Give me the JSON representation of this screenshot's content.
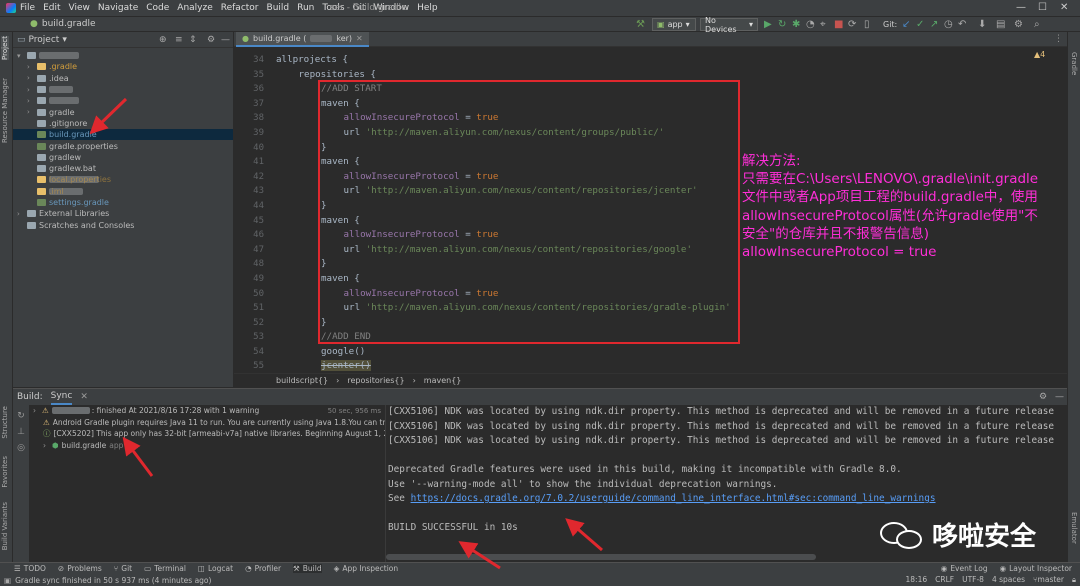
{
  "menubar": {
    "items": [
      "File",
      "Edit",
      "View",
      "Navigate",
      "Code",
      "Analyze",
      "Refactor",
      "Build",
      "Run",
      "Tools",
      "Git",
      "Window",
      "Help"
    ],
    "window_title": "ser - build.gradle"
  },
  "navbar": {
    "breadcrumb": "build.gradle",
    "run_config": "app",
    "device": "No Devices",
    "git_label": "Git:"
  },
  "project_panel": {
    "title": "Project",
    "items": [
      {
        "label": "",
        "level": 0,
        "arrow": "▾",
        "icon": "folder",
        "blurred": true,
        "blur_w": 40
      },
      {
        "label": ".gradle",
        "level": 1,
        "arrow": "›",
        "icon": "folder-orange",
        "color": "#d29e3c"
      },
      {
        "label": ".idea",
        "level": 1,
        "arrow": "›",
        "icon": "folder"
      },
      {
        "label": "",
        "level": 1,
        "arrow": "›",
        "icon": "folder",
        "blurred": true,
        "blur_w": 24
      },
      {
        "label": "",
        "level": 1,
        "arrow": "›",
        "icon": "folder",
        "blurred": true,
        "blur_w": 30
      },
      {
        "label": "gradle",
        "level": 1,
        "arrow": "›",
        "icon": "folder"
      },
      {
        "label": ".gitignore",
        "level": 1,
        "arrow": "",
        "icon": "file"
      },
      {
        "label": "build.gradle",
        "level": 1,
        "arrow": "",
        "icon": "gradle",
        "selected": true,
        "color": "#6897bb"
      },
      {
        "label": "gradle.properties",
        "level": 1,
        "arrow": "",
        "icon": "gradle"
      },
      {
        "label": "gradlew",
        "level": 1,
        "arrow": "",
        "icon": "file"
      },
      {
        "label": "gradlew.bat",
        "level": 1,
        "arrow": "",
        "icon": "file"
      },
      {
        "label": "local.properties",
        "level": 1,
        "arrow": "",
        "icon": "file-orange",
        "color": "#d29e3c",
        "blurred": true,
        "blur_w": 50
      },
      {
        "label": ".iml",
        "level": 1,
        "arrow": "",
        "icon": "file-orange",
        "color": "#d29e3c",
        "blurred": true,
        "blur_w": 34
      },
      {
        "label": "settings.gradle",
        "level": 1,
        "arrow": "",
        "icon": "gradle",
        "color": "#6897bb"
      },
      {
        "label": "External Libraries",
        "level": 0,
        "arrow": "›",
        "icon": "lib"
      },
      {
        "label": "Scratches and Consoles",
        "level": 0,
        "arrow": "",
        "icon": "scratch"
      }
    ]
  },
  "editor": {
    "tab_label": "build.gradle (",
    "tab_label_suffix": "ker)",
    "warnings": "▲4",
    "line_numbers": [
      "34",
      "35",
      "36",
      "37",
      "38",
      "39",
      "40",
      "41",
      "42",
      "43",
      "44",
      "45",
      "46",
      "47",
      "48",
      "49",
      "50",
      "51",
      "52",
      "53",
      "54",
      "55"
    ],
    "breadcrumbs": [
      "buildscript{}",
      "repositories{}",
      "maven{}"
    ],
    "code_lines": [
      {
        "indent": 0,
        "parts": [
          [
            "id",
            "allprojects {"
          ]
        ]
      },
      {
        "indent": 1,
        "parts": [
          [
            "id",
            "repositories {"
          ]
        ]
      },
      {
        "indent": 2,
        "parts": [
          [
            "cm",
            "//ADD START"
          ]
        ]
      },
      {
        "indent": 2,
        "parts": [
          [
            "id",
            "maven {"
          ]
        ]
      },
      {
        "indent": 3,
        "parts": [
          [
            "pr",
            "allowInsecureProtocol"
          ],
          [
            "id",
            " = "
          ],
          [
            "kw",
            "true"
          ]
        ]
      },
      {
        "indent": 3,
        "parts": [
          [
            "id",
            "url "
          ],
          [
            "str",
            "'http://maven.aliyun.com/nexus/content/groups/public/'"
          ]
        ]
      },
      {
        "indent": 2,
        "parts": [
          [
            "id",
            "}"
          ]
        ]
      },
      {
        "indent": 2,
        "parts": [
          [
            "id",
            "maven {"
          ]
        ]
      },
      {
        "indent": 3,
        "parts": [
          [
            "pr",
            "allowInsecureProtocol"
          ],
          [
            "id",
            " = "
          ],
          [
            "kw",
            "true"
          ]
        ]
      },
      {
        "indent": 3,
        "parts": [
          [
            "id",
            "url "
          ],
          [
            "str",
            "'http://maven.aliyun.com/nexus/content/repositories/jcenter'"
          ]
        ]
      },
      {
        "indent": 2,
        "parts": [
          [
            "id",
            "}"
          ]
        ]
      },
      {
        "indent": 2,
        "parts": [
          [
            "id",
            "maven {"
          ]
        ]
      },
      {
        "indent": 3,
        "parts": [
          [
            "pr",
            "allowInsecureProtocol"
          ],
          [
            "id",
            " = "
          ],
          [
            "kw",
            "true"
          ]
        ]
      },
      {
        "indent": 3,
        "parts": [
          [
            "id",
            "url "
          ],
          [
            "str",
            "'http://maven.aliyun.com/nexus/content/repositories/google'"
          ]
        ]
      },
      {
        "indent": 2,
        "parts": [
          [
            "id",
            "}"
          ]
        ]
      },
      {
        "indent": 2,
        "parts": [
          [
            "id",
            "maven {"
          ]
        ]
      },
      {
        "indent": 3,
        "parts": [
          [
            "pr",
            "allowInsecureProtocol"
          ],
          [
            "id",
            " = "
          ],
          [
            "kw",
            "true"
          ]
        ]
      },
      {
        "indent": 3,
        "parts": [
          [
            "id",
            "url "
          ],
          [
            "str",
            "'http://maven.aliyun.com/nexus/content/repositories/gradle-plugin'"
          ]
        ]
      },
      {
        "indent": 2,
        "parts": [
          [
            "id",
            "}"
          ]
        ]
      },
      {
        "indent": 2,
        "parts": [
          [
            "cm",
            "//ADD END"
          ]
        ]
      },
      {
        "indent": 2,
        "parts": [
          [
            "id",
            "google()"
          ]
        ]
      },
      {
        "indent": 2,
        "parts": [
          [
            "strike",
            "jcenter()"
          ]
        ]
      }
    ]
  },
  "annotation": {
    "lines": [
      "解决方法:",
      "只需要在C:\\Users\\LENOVO\\.gradle\\init.gradle",
      "文件中或者App项目工程的build.gradle中，使用",
      "allowInsecureProtocol属性(允许gradle使用\"不",
      "安全\"的仓库并且不报警告信息)",
      "allowInsecureProtocol = true"
    ],
    "color": "#ff2ed8"
  },
  "build_panel": {
    "title": "Build:",
    "tab": "Sync",
    "tree": [
      {
        "text": ": finished At 2021/8/16 17:28 with 1 warning",
        "time": "50 sec, 956 ms",
        "icon": "warn",
        "indent": 0,
        "blurred": true
      },
      {
        "text": "Android Gradle plugin requires Java 11 to run. You are currently using Java 1.8.You can try some",
        "icon": "warn",
        "indent": 1
      },
      {
        "text": "[CXX5202] This app only has 32-bit [armeabi-v7a] native libraries. Beginning August 1, 2019 Goo",
        "icon": "info",
        "indent": 1
      },
      {
        "text": "build.gradle",
        "suffix": "app",
        "icon": "gradle-green",
        "indent": 1
      }
    ],
    "console": [
      "[CXX5106] NDK was located by using ndk.dir property. This method is deprecated and will be removed in a future release",
      "[CXX5106] NDK was located by using ndk.dir property. This method is deprecated and will be removed in a future release",
      "[CXX5106] NDK was located by using ndk.dir property. This method is deprecated and will be removed in a future release",
      "",
      "Deprecated Gradle features were used in this build, making it incompatible with Gradle 8.0.",
      "Use '--warning-mode all' to show the individual deprecation warnings.",
      "See ",
      "",
      "BUILD SUCCESSFUL in 10s"
    ],
    "link": "https://docs.gradle.org/7.0.2/userguide/command_line_interface.html#sec:command_line_warnings"
  },
  "toolstrip": {
    "items": [
      "TODO",
      "Problems",
      "Git",
      "Terminal",
      "Logcat",
      "Profiler",
      "Build",
      "App Inspection"
    ],
    "right_items": [
      "Event Log",
      "Layout Inspector"
    ],
    "active": "Build"
  },
  "statusbar": {
    "message": "Gradle sync finished in 50 s 937 ms (4 minutes ago)",
    "position": "18:16",
    "line_sep": "CRLF",
    "encoding": "UTF-8",
    "indent": "4 spaces",
    "branch": "master"
  },
  "left_tabs": [
    "Project",
    "Resource Manager",
    "Structure",
    "Favorites",
    "Build Variants"
  ],
  "right_tabs": [
    "Gradle",
    "Emulator"
  ],
  "watermark": {
    "text": "哆啦安全"
  }
}
